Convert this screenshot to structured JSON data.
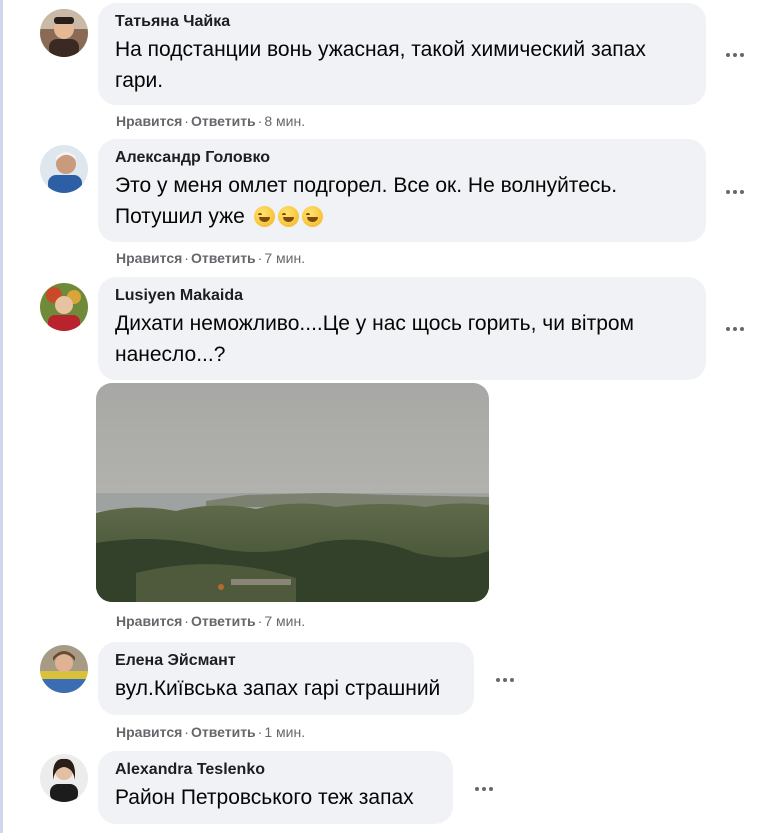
{
  "actions": {
    "like": "Нравится",
    "reply": "Ответить",
    "separator": "·"
  },
  "comments": [
    {
      "author": "Татьяна Чайка",
      "text": "На подстанции вонь ужасная, такой химический запах гари.",
      "time": "8 мин.",
      "avatar_icon": "avatar-person-icon"
    },
    {
      "author": "Александр Головко",
      "text": "Это у меня омлет подгорел. Все ок. Не волнуйтесь. Потушил уже",
      "emoji": "grinning-sweat-face x3",
      "time": "7 мин.",
      "avatar_icon": "avatar-person-icon"
    },
    {
      "author": "Lusiyen Makaida",
      "text": "Дихати неможливо....Це у нас щось горить, чи вітром нанесло...?",
      "time": "7 мин.",
      "avatar_icon": "avatar-person-icon",
      "photo": "smoky-river-landscape-photo"
    },
    {
      "author": "Елена Эйсмант",
      "text": "вул.Київська запах гарі страшний",
      "time": "1 мин.",
      "avatar_icon": "avatar-person-icon"
    },
    {
      "author": "Alexandra Teslenko",
      "text": "Район Петровського теж запах",
      "avatar_icon": "avatar-person-icon"
    }
  ],
  "colors": {
    "bubble": "#f0f2f5",
    "secondary_text": "#65676b",
    "primary_text": "#050505"
  }
}
